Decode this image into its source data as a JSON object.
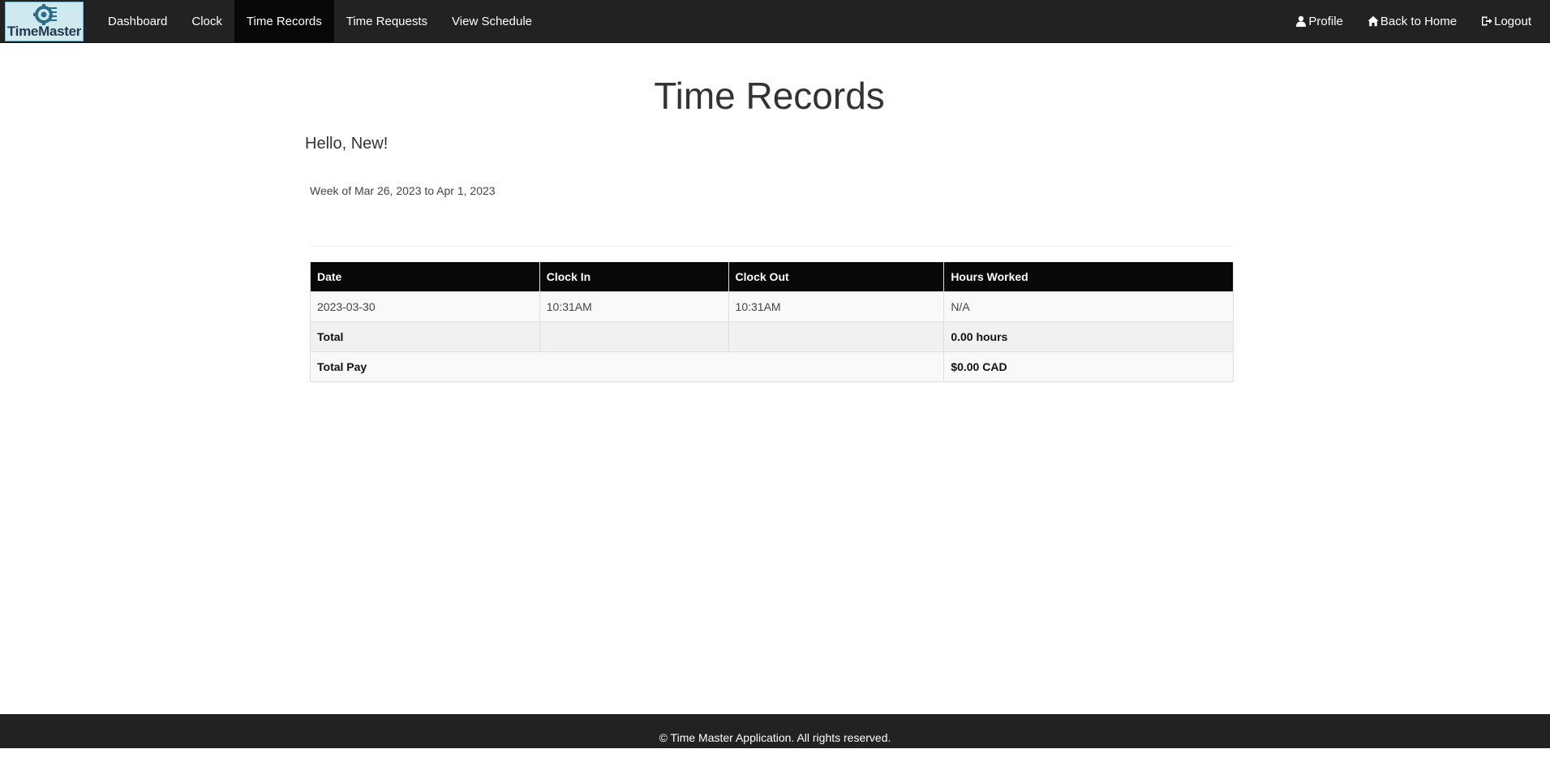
{
  "brand": {
    "name": "TimeMaster"
  },
  "nav": {
    "left": [
      {
        "label": "Dashboard",
        "active": false
      },
      {
        "label": "Clock",
        "active": false
      },
      {
        "label": "Time Records",
        "active": true
      },
      {
        "label": "Time Requests",
        "active": false
      },
      {
        "label": "View Schedule",
        "active": false
      }
    ],
    "right": [
      {
        "label": "Profile",
        "icon": "user-icon"
      },
      {
        "label": "Back to Home",
        "icon": "home-icon"
      },
      {
        "label": "Logout",
        "icon": "logout-icon"
      }
    ]
  },
  "page": {
    "title": "Time Records",
    "greeting": "Hello, New!",
    "week": "Week of Mar 26, 2023 to Apr 1, 2023"
  },
  "table": {
    "headers": [
      "Date",
      "Clock In",
      "Clock Out",
      "Hours Worked"
    ],
    "rows": [
      {
        "date": "2023-03-30",
        "clock_in": "10:31AM",
        "clock_out": "10:31AM",
        "hours": "N/A"
      }
    ],
    "total": {
      "label": "Total",
      "hours": "0.00 hours"
    },
    "total_pay": {
      "label": "Total Pay",
      "amount": "$0.00 CAD"
    }
  },
  "footer": {
    "text": "© Time Master Application. All rights reserved."
  },
  "colors": {
    "navbar": "#222222",
    "active_nav": "#080808",
    "table_header": "#080808"
  }
}
